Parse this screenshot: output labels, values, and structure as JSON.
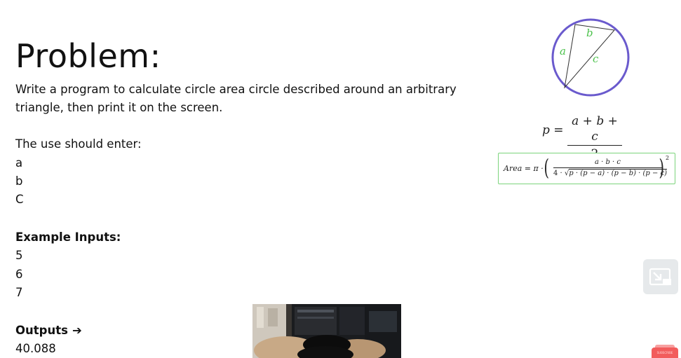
{
  "slide": {
    "title": "Problem:",
    "description": "Write a program to calculate  circle area circle described around an arbitrary triangle, then print it on the screen.",
    "enter_label": "The use should enter:",
    "inputs": [
      "a",
      "b",
      "C"
    ],
    "example_label": "Example Inputs:",
    "examples": [
      "5",
      "6",
      "7"
    ],
    "outputs_label": "Outputs",
    "output_value": "40.088"
  },
  "diagram": {
    "side_a": "a",
    "side_b": "b",
    "side_c": "c",
    "circle_color": "#6a5acd",
    "side_label_color": "#4cc24c"
  },
  "formula_p": {
    "lhs": "p =",
    "numerator": "a + b + c",
    "denominator": "2"
  },
  "formula_area": {
    "label": "Area = π ·",
    "numerator": "a · b · c",
    "denominator_prefix": "4 · ",
    "denominator_radicand": "p · (p − a) · (p − b) · (p − c)",
    "exponent": "2",
    "border_color": "#7cd47c"
  },
  "overlay": {
    "subscribe_label": "SUBSCRIBE"
  }
}
